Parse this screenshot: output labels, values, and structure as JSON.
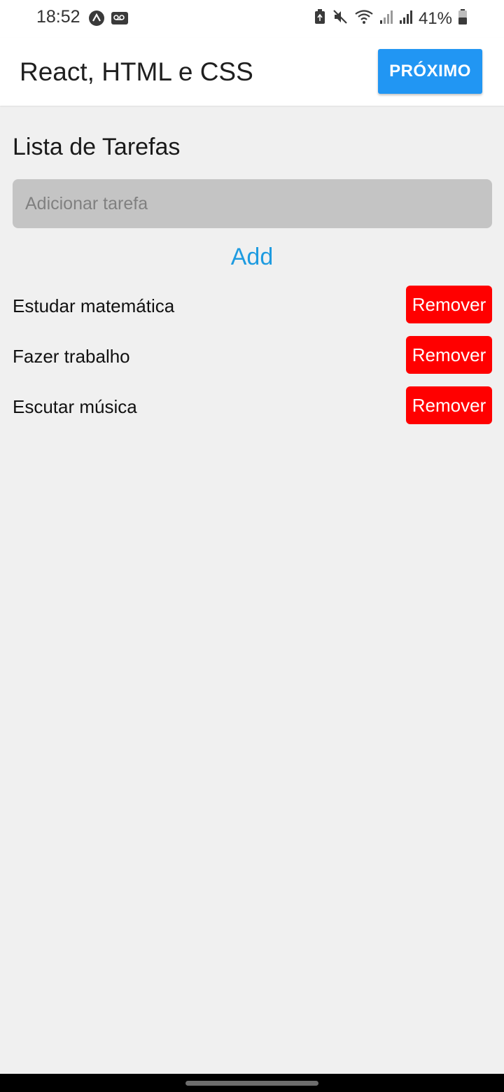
{
  "status_bar": {
    "time": "18:52",
    "battery_percent": "41%",
    "icons": [
      "expo-icon",
      "voicemail-icon",
      "battery-saver-icon",
      "mute-icon",
      "wifi-icon",
      "signal-icon",
      "signal-icon",
      "battery-icon"
    ]
  },
  "header": {
    "title": "React, HTML e CSS",
    "next_label": "PRÓXIMO",
    "accent_color": "#2196f3"
  },
  "main": {
    "list_title": "Lista de Tarefas",
    "input_placeholder": "Adicionar tarefa",
    "input_value": "",
    "add_label": "Add",
    "tasks": [
      {
        "label": "Estudar matemática",
        "remove_label": "Remover"
      },
      {
        "label": "Fazer trabalho",
        "remove_label": "Remover"
      },
      {
        "label": "Escutar música",
        "remove_label": "Remover"
      }
    ],
    "remove_color": "#ff0000"
  }
}
